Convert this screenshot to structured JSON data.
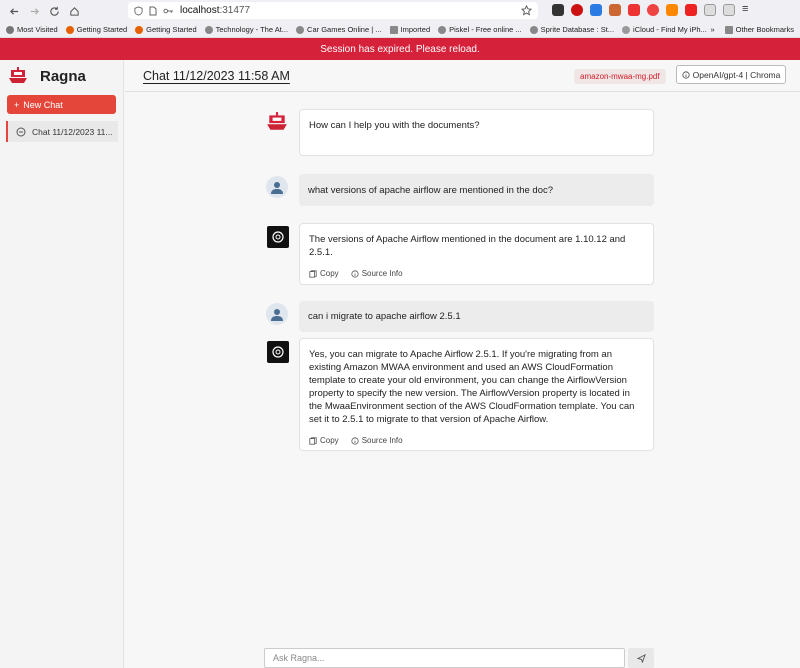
{
  "browser": {
    "url_host": "localhost",
    "url_port": ":31477",
    "bookmarks": [
      {
        "label": "Most Visited",
        "icon": "gear-icon",
        "color": "#777777"
      },
      {
        "label": "Getting Started",
        "icon": "firefox-icon",
        "color": "#e66000"
      },
      {
        "label": "Getting Started",
        "icon": "firefox-icon",
        "color": "#e66000"
      },
      {
        "label": "Technology - The At...",
        "icon": "globe-icon",
        "color": "#777777"
      },
      {
        "label": "Car Games Online | ...",
        "icon": "globe-icon",
        "color": "#777777"
      },
      {
        "label": "Imported",
        "icon": "folder-icon",
        "color": "#777777"
      },
      {
        "label": "Piskel - Free online ...",
        "icon": "globe-icon",
        "color": "#777777"
      },
      {
        "label": "Sprite Database : St...",
        "icon": "globe-icon",
        "color": "#777777"
      },
      {
        "label": "iCloud - Find My iPh...",
        "icon": "apple-icon",
        "color": "#999999"
      }
    ],
    "other_bookmarks": "Other Bookmarks",
    "overflow_label": "»"
  },
  "banner": {
    "text": "Session has expired. Please reload.",
    "color": "#d6213a"
  },
  "sidebar": {
    "app_name": "Ragna",
    "new_chat_label": "New Chat",
    "new_chat_icon": "+",
    "chats": [
      {
        "label": "Chat 11/12/2023 11..."
      }
    ]
  },
  "header": {
    "title": "Chat 11/12/2023 11:58 AM",
    "source_document": "amazon-mwaa-mg.pdf",
    "model_label": "OpenAI/gpt-4 | Chroma"
  },
  "messages": [
    {
      "role": "ragna",
      "text": "How can I help you with the documents?"
    },
    {
      "role": "user",
      "text": "what versions of apache airflow are mentioned in the doc?"
    },
    {
      "role": "assistant",
      "text": "The versions of Apache Airflow mentioned in the document are 1.10.12 and 2.5.1.",
      "copy_label": "Copy",
      "source_label": "Source Info"
    },
    {
      "role": "user",
      "text": "can i migrate to apache airflow 2.5.1"
    },
    {
      "role": "assistant",
      "text": "Yes, you can migrate to Apache Airflow 2.5.1. If you're migrating from an existing Amazon MWAA environment and used an AWS CloudFormation template to create your old environment, you can change the AirflowVersion property to specify the new version. The AirflowVersion property is located in the MwaaEnvironment section of the AWS CloudFormation template. You can set it to 2.5.1 to migrate to that version of Apache Airflow.",
      "copy_label": "Copy",
      "source_label": "Source Info"
    }
  ],
  "input": {
    "placeholder": "Ask Ragna..."
  },
  "colors": {
    "accent": "#e4473a",
    "banner": "#d6213a"
  }
}
